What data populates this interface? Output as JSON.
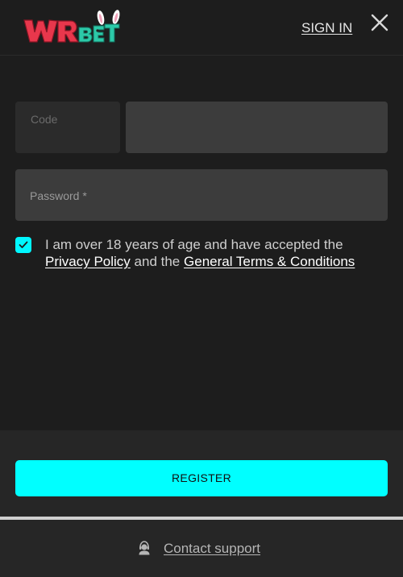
{
  "header": {
    "logo_text": "WRBET",
    "signin_label": "SIGN IN"
  },
  "form": {
    "code_placeholder": "Code",
    "phone_value": "",
    "password_placeholder": "Password *",
    "age_checkbox_checked": true,
    "terms_text_before": "I am over 18 years of age and have accepted the",
    "privacy_link": "Privacy Policy",
    "terms_connector": "and the",
    "terms_link": "General Terms & Conditions"
  },
  "actions": {
    "register_label": "REGISTER"
  },
  "footer": {
    "support_label": "Contact support"
  },
  "colors": {
    "accent": "#00ffff",
    "background": "#1d1d1d",
    "input": "#3c3c3c",
    "logo_red": "#e8374c",
    "logo_green": "#2cc9a8"
  }
}
